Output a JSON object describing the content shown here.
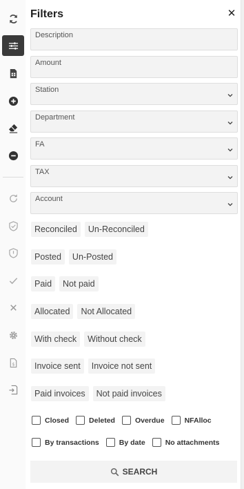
{
  "panel": {
    "title": "Filters"
  },
  "fields": [
    {
      "label": "Description",
      "type": "text"
    },
    {
      "label": "Amount",
      "type": "text"
    },
    {
      "label": "Station",
      "type": "select"
    },
    {
      "label": "Department",
      "type": "select"
    },
    {
      "label": "FA",
      "type": "select"
    },
    {
      "label": "TAX",
      "type": "select"
    },
    {
      "label": "Account",
      "type": "select"
    }
  ],
  "chip_rows": [
    [
      "Reconciled",
      "Un-Reconciled"
    ],
    [
      "Posted",
      "Un-Posted"
    ],
    [
      "Paid",
      "Not paid"
    ],
    [
      "Allocated",
      "Not Allocated"
    ],
    [
      "With check",
      "Without check"
    ],
    [
      "Invoice sent",
      "Invoice not sent"
    ],
    [
      "Paid invoices",
      "Not paid invoices"
    ]
  ],
  "checkbox_rows": [
    [
      "Closed",
      "Deleted",
      "Overdue",
      "NFAlloc"
    ],
    [
      "By transactions",
      "By date",
      "No attachments"
    ]
  ],
  "search_label": "SEARCH",
  "rail_icons": [
    "refresh-icon",
    "sliders-icon",
    "spreadsheet-icon",
    "add-circle-icon",
    "eraser-icon",
    "remove-circle-icon",
    "redo-icon",
    "shield-check-icon",
    "shield-icon",
    "check-icon",
    "close-icon",
    "gear-icon",
    "document-dollar-icon",
    "export-icon"
  ]
}
